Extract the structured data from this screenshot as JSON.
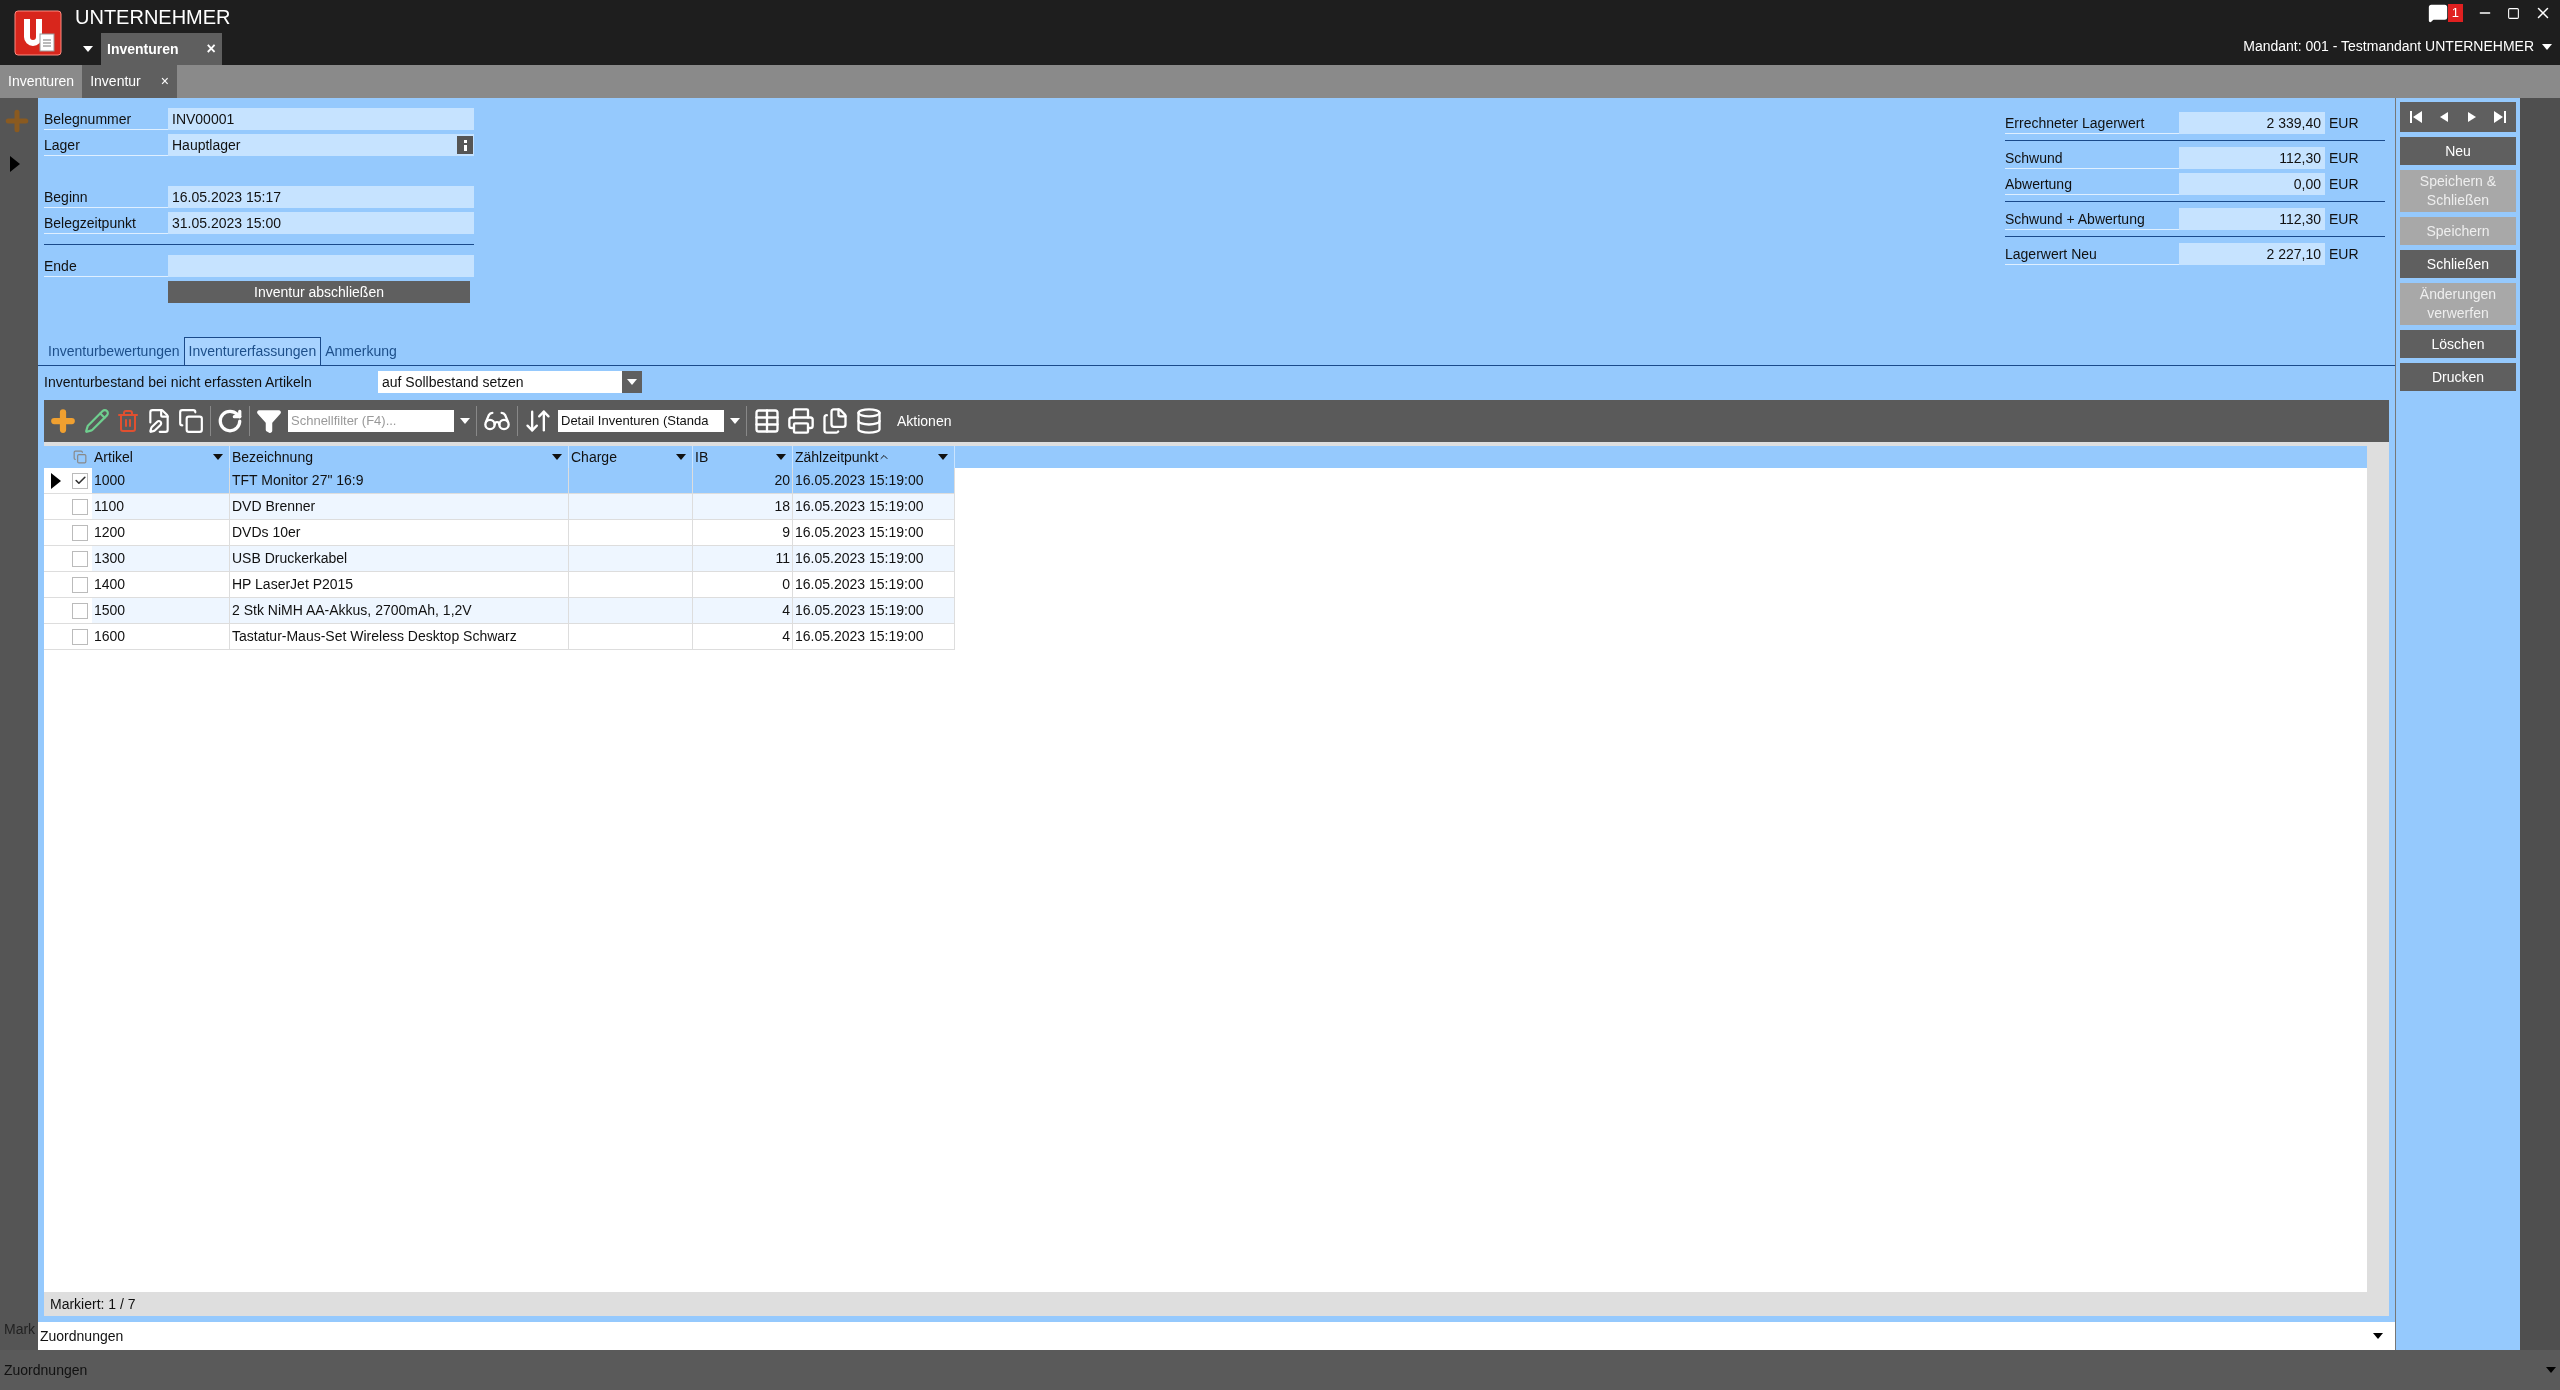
{
  "app": {
    "title": "UNTERNEHMER",
    "tabs": [
      {
        "label": "Inventuren",
        "selected": true,
        "close": "×"
      }
    ],
    "notifications": "1",
    "mandant": "Mandant: 001 - Testmandant UNTERNEHMER"
  },
  "doc_tabs": [
    {
      "label": "Inventuren",
      "selected": false
    },
    {
      "label": "Inventur",
      "selected": true,
      "close": "×"
    }
  ],
  "form": {
    "fields": [
      {
        "label": "Belegnummer",
        "value": "INV00001",
        "kind": "text"
      },
      {
        "label": "Lager",
        "value": "Hauptlager",
        "kind": "lookup"
      },
      {
        "label": "Beginn",
        "value": "16.05.2023 15:17",
        "kind": "text",
        "gap": true
      },
      {
        "label": "Belegzeitpunkt",
        "value": "31.05.2023 15:00",
        "kind": "text",
        "rule": true
      },
      {
        "label": "Ende",
        "kind": "text"
      }
    ],
    "finish_button": "Inventur abschließen"
  },
  "summary": [
    {
      "label": "Errechneter Lagerwert",
      "value": "2 339,40",
      "unit": "EUR",
      "rule": true
    },
    {
      "label": "Schwund",
      "value": "112,30",
      "unit": "EUR"
    },
    {
      "label": "Abwertung",
      "value": "0,00",
      "unit": "EUR",
      "rule": true
    },
    {
      "label": "Schwund + Abwertung",
      "value": "112,30",
      "unit": "EUR",
      "rule": true
    },
    {
      "label": "Lagerwert Neu",
      "value": "2 227,10",
      "unit": "EUR"
    }
  ],
  "actions": [
    {
      "label": "Neu",
      "disabled": false
    },
    {
      "label": "Speichern & Schließen",
      "disabled": true
    },
    {
      "label": "Speichern",
      "disabled": true
    },
    {
      "label": "Schließen",
      "disabled": false
    },
    {
      "label": "Änderungen verwerfen",
      "disabled": true
    },
    {
      "label": "Löschen",
      "disabled": false
    },
    {
      "label": "Drucken",
      "disabled": false
    }
  ],
  "tabs": [
    {
      "label": "Inventurbewertungen",
      "selected": false
    },
    {
      "label": "Inventurerfassungen",
      "selected": true
    },
    {
      "label": "Anmerkung",
      "selected": false
    }
  ],
  "option": {
    "label": "Inventurbestand bei nicht erfassten Artikeln",
    "value": "auf Sollbestand setzen"
  },
  "toolbar": {
    "filter_placeholder": "Schnellfilter (F4)...",
    "layout": "Detail Inventuren (Standa",
    "actions": "Aktionen"
  },
  "table": {
    "columns": [
      "Artikel",
      "Bezeichnung",
      "Charge",
      "IB",
      "Zählzeitpunkt"
    ],
    "rows": [
      {
        "selected": true,
        "checked": true,
        "cells": [
          "1000",
          "TFT Monitor 27\" 16:9",
          "",
          "20",
          "16.05.2023 15:19:00"
        ]
      },
      {
        "selected": false,
        "checked": false,
        "cells": [
          "1100",
          "DVD Brenner",
          "",
          "18",
          "16.05.2023 15:19:00"
        ]
      },
      {
        "selected": false,
        "checked": false,
        "cells": [
          "1200",
          "DVDs 10er",
          "",
          "9",
          "16.05.2023 15:19:00"
        ]
      },
      {
        "selected": false,
        "checked": false,
        "cells": [
          "1300",
          "USB Druckerkabel",
          "",
          "11",
          "16.05.2023 15:19:00"
        ]
      },
      {
        "selected": false,
        "checked": false,
        "cells": [
          "1400",
          "HP LaserJet P2015",
          "",
          "0",
          "16.05.2023 15:19:00"
        ]
      },
      {
        "selected": false,
        "checked": false,
        "cells": [
          "1500",
          "2 Stk NiMH AA-Akkus, 2700mAh, 1,2V",
          "",
          "4",
          "16.05.2023 15:19:00"
        ]
      },
      {
        "selected": false,
        "checked": false,
        "cells": [
          "1600",
          "Tastatur-Maus-Set Wireless Desktop Schwarz",
          "",
          "4",
          "16.05.2023 15:19:00"
        ]
      }
    ],
    "status": "Markiert: 1 / 7"
  },
  "assignments": "Zuordnungen",
  "background": {
    "status": "Mark",
    "assignments": "Zuordnungen"
  }
}
